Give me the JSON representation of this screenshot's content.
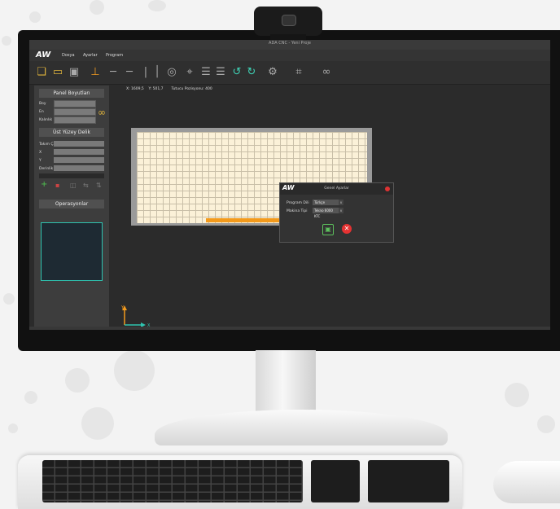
{
  "window": {
    "title": "ADA CNC - Yeni Proje"
  },
  "app": {
    "logo": "AW"
  },
  "menu": [
    "Dosya",
    "Ayarlar",
    "Program"
  ],
  "toolbar_icons": [
    "new-file-icon",
    "open-folder-icon",
    "save-icon",
    "vertical-drill-icon",
    "horizontal-left-drill-icon",
    "horizontal-right-drill-icon",
    "single-line-icon",
    "double-line-icon",
    "circle-drill-icon",
    "location-icon",
    "grid-horizontal-icon",
    "grid-double-icon",
    "rotate-left-icon",
    "rotate-right-icon",
    "settings-gear-icon",
    "center-target-icon",
    "link-icon"
  ],
  "sidebar": {
    "panel_title": "Panel Boyutları",
    "fields": [
      {
        "label": "Boy",
        "value": ""
      },
      {
        "label": "En",
        "value": ""
      },
      {
        "label": "Kalınlık",
        "value": ""
      }
    ],
    "drill_title": "Üst Yüzey Delik",
    "drill_fields": [
      {
        "label": "Takım Çapı",
        "value": ""
      },
      {
        "label": "X",
        "value": ""
      },
      {
        "label": "Y",
        "value": ""
      },
      {
        "label": "Derinlik",
        "value": ""
      }
    ],
    "ops_title": "Operasyonlar"
  },
  "canvas": {
    "coords": "X: 1609,5    Y: 501,7       Tutucu Pozisyonu: 400",
    "axis_x": "X",
    "axis_y": "Y"
  },
  "dialog": {
    "logo": "AW",
    "title": "Genel Ayarlar",
    "language_label": "Program Dili",
    "language_value": "Türkçe",
    "machine_label": "Makina Tipi",
    "machine_value": "Tekno 6000 KTC"
  },
  "colors": {
    "accent": "#f39a1c",
    "teal": "#2fc4b0",
    "panel": "#3d3d3d",
    "canvas": "#2b2b2b",
    "board": "#fbf1d8"
  }
}
